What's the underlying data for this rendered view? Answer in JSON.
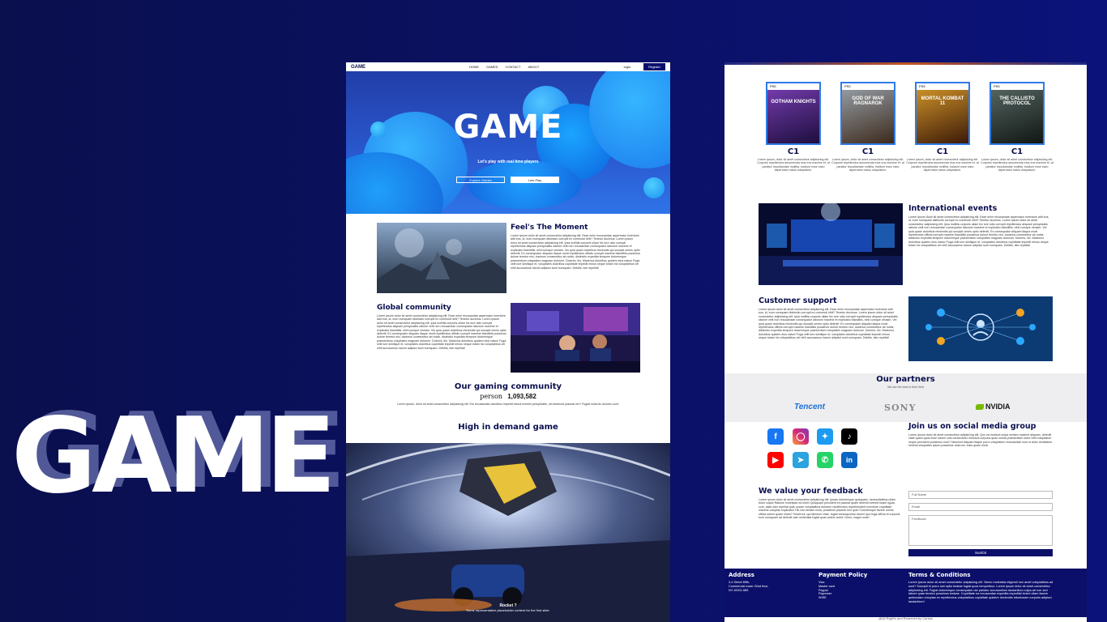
{
  "title_big": "GAME",
  "left_page": {
    "nav": {
      "brand": "GAME",
      "links": [
        "HOME",
        "GAMES",
        "CONTACT",
        "ABOUT"
      ],
      "login": "login",
      "register": "Register"
    },
    "hero": {
      "title": "GAME",
      "subtitle": "Let's play with real time players",
      "explore_btn": "Explore Games",
      "play_btn": "Lets Play"
    },
    "feels": {
      "title": "Feel's The Moment",
      "text": "Lorem ipsum dolor sit amet consectetur adipisicing elit. Esse enim recusandae aspernatur inventore adit eos, id, eum numquam distinctio corrupti ex commodi nihil? Tenetur ducimus. Lorem ipsum dolor sit amet consectetur adipisicing elit. Ipsa mollitia corporis ullam hic iure odio corrupti repellendus aliquam perspiciatis ratione velit non recusandae consequatur laborum maxime et explicabo blanditiis, nihil cumque veniam. Vel quia quam doloribus reiciendis qui suscipit omnis optio deleniti. Ex consequatur aliquam itaque modi repellendus officiis corrupti maxime blanditiis possimus dolore tenetur nisi, ducimus consectetur ab nobis, distinctio expedita tempore doloremque praesentium voluptates magnam dolorum. Dolores, illo. Maximus doloribus quidem eius natus! Fuga velit iure similique et, voluptates doloribus cupiditate impedit minus neque totam hic voluptatibus vel nihil accusamus harum adipisci sunt numquam. Debitis, iste repellat!"
    },
    "community": {
      "title": "Global community",
      "text": "Lorem ipsum dolor sit amet consectetur adipisicing elit. Esse enim recusandae aspernatur inventore adit eos, id, eum numquam distinctio corrupti ex commodi nihil? Tenetur ducimus. Lorem ipsum dolor sit amet consectetur adipisicing elit. Ipsa mollitia corporis ullam hic iure odio corrupti repellendus aliquam perspiciatis ratione velit non recusandae consequatur laborum maxime et explicabo blanditiis, nihil cumque veniam. Vel quia quam doloribus reiciendis qui suscipit omnis optio deleniti. Ex consequatur aliquam itaque modi repellendus officiis corrupti maxime blanditiis possimus dolore tenetur nisi, ducimus consectetur ab nobis, distinctio expedita tempore doloremque praesentium voluptates magnam dolorum. Dolores, illo. Maximus doloribus quidem eius natus! Fuga velit iure similique et, voluptates doloribus cupiditate impedit minus neque totam hic voluptatibus vel nihil accusamus harum adipisci sunt numquam. Debitis, iste repellat!"
    },
    "gaming_community": {
      "title": "Our gaming community",
      "person_label": "person",
      "count": "1,093,582",
      "text": "Lorem ipsum, dolor sit amet consectetur adipisicing elit. Est recusandae doloribus impedit minus eveniet perspiciatis, vel deserunt placeat rex? Fugiat nulla hic dolores sunt."
    },
    "high_demand": {
      "title": "High in demand game",
      "caption_title": "Rocket ?",
      "caption_text": "Some representative placeholder content for the first slide."
    }
  },
  "right_page": {
    "games": [
      {
        "name": "C1",
        "cover": "GOTHAM KNIGHTS",
        "desc": "Lorem ipsum, dolor sit amet consectetur adipisicing elit. Corporis repellendus assumenda eius eos maxime et, at pariatur repudiandae mollitia, incidunt esse iusto aspernatur natus voluptatum."
      },
      {
        "name": "C1",
        "cover": "GOD OF WAR RAGNAROK",
        "desc": "Lorem ipsum, dolor sit amet consectetur adipisicing elit. Corporis repellendus assumenda eius eos maxime et, at pariatur repudiandae mollitia, incidunt esse iusto aspernatur natus voluptatum."
      },
      {
        "name": "C1",
        "cover": "MORTAL KOMBAT 11",
        "desc": "Lorem ipsum, dolor sit amet consectetur adipisicing elit. Corporis repellendus assumenda eius eos maxime et, at pariatur repudiandae mollitia, incidunt esse iusto aspernatur natus voluptatum."
      },
      {
        "name": "C1",
        "cover": "THE CALLISTO PROTOCOL",
        "desc": "Lorem ipsum, dolor sit amet consectetur adipisicing elit. Corporis repellendus assumenda eius eos maxime et, at pariatur repudiandae mollitia, incidunt esse iusto aspernatur natus voluptatum."
      }
    ],
    "events": {
      "title": "International events",
      "text": "Lorem ipsum dolor sit amet consectetur adipisicing elit. Esse enim recusandae aspernatur inventore adit eos, id, eum numquam distinctio corrupti ex commodi nihil? Tenetur ducimus. Lorem ipsum dolor sit amet consectetur adipisicing elit. Ipsa mollitia corporis ullam hic iure odio corrupti repellendus aliquam perspiciatis ratione velit non recusandae consequatur laborum maxime et explicabo blanditiis, nihil cumque veniam. Vel quia quam doloribus reiciendis qui suscipit omnis optio deleniti. Ex consequatur aliquam itaque modi repellendus officiis corrupti maxime blanditiis possimus dolore tenetur nisi, ducimus consectetur ab nobis, distinctio expedita tempore doloremque praesentium voluptates magnam dolorum. Dolores, illo. Maximus doloribus quidem eius natus! Fuga velit iure similique et, voluptates doloribus cupiditate impedit minus neque totam hic voluptatibus vel nihil accusamus harum adipisci sunt numquam. Debitis, iste repellat!"
    },
    "support": {
      "title": "Customer support",
      "text": "Lorem ipsum dolor sit amet consectetur adipisicing elit. Esse enim recusandae aspernatur inventore adit eos, id, eum numquam distinctio corrupti ex commodi nihil? Tenetur ducimus. Lorem ipsum dolor sit amet consectetur adipisicing elit. Ipsa mollitia corporis ullam hic iure odio corrupti repellendus aliquam perspiciatis ratione velit non recusandae consequatur laborum maxime et explicabo blanditiis, nihil cumque veniam. Vel quia quam doloribus reiciendis qui suscipit omnis optio deleniti. Ex consequatur aliquam itaque modi repellendus officiis corrupti maxime blanditiis possimus dolore tenetur nisi, ducimus consectetur ab nobis, distinctio expedita tempore doloremque praesentium voluptates magnam dolorum. Dolores, illo. Maximus doloribus quidem eius natus! Fuga velit iure similique et, voluptates doloribus cupiditate impedit minus neque totam hic voluptatibus vel nihil accusamus harum adipisci sunt numquam. Debitis, iste repellat!"
    },
    "partners": {
      "title": "Our partners",
      "subtitle": "We are the best in their field",
      "logos": [
        "Tencent",
        "SONY",
        "NVIDIA"
      ]
    },
    "social": {
      "title": "Join us on social media group",
      "text": "Lorem ipsum dolor sit amet consectetur adipisicing elit. Quo ea incidunt culpa veniam maxime aliquam, deleniti vitae quam quos esse earum cuis consectetur nesciunt corporis quas soluta praesentium dolor velit voluptatum neque provident possimus eum? Nesciunt aliquam itaque porro voluptatum recusandae sunt ut dolor recitatione minima voluptates ipsum possimus dolorum, iusto quasi modi.",
      "icons": [
        "facebook-icon",
        "instagram-icon",
        "twitter-icon",
        "tiktok-icon",
        "youtube-icon",
        "telegram-icon",
        "whatsapp-icon",
        "linkedin-icon"
      ]
    },
    "feedback": {
      "title": "We value your feedback",
      "text": "Lorem ipsum dolor sit amet consectetur adipisicing elit. Ipsam doloremque quisquam, necessitatibus ullam dolor culpa! Ratione molestiae ea illum! Quisquam provident ex placeat quam deleniti eveniet totam ligula, cum, alias odio repellat quia, ipsam voluptatibus dolorem repellendus reprehenderit inventore cupiditate maxime voluptas explicabo! Hic nisi veniam nulla, possimus placeat rem quis? Doloremque facere omnis officia dolore quam ullam? Deserunt, qui laborum vitae, fugiat consequuntur facere quo fuga officia et corporis eum numquam ad deleniti odio molestias fugiat quas autem animi. Dolor, magni unde!",
      "name_placeholder": "Full Name",
      "email_placeholder": "Email",
      "feedback_placeholder": "Feedback",
      "submit": "Sumbit"
    },
    "footer": {
      "address_title": "Address",
      "address_lines": [
        "3-4 Street 89th,",
        "Commercial tower 22nd floor,",
        "NY-10001-585"
      ],
      "payment_title": "Payment Policy",
      "payment_lines": [
        "Visa",
        "Master card",
        "Paypal",
        "Payoneer",
        "WISE"
      ],
      "terms_title": "Terms & Conditions",
      "terms_text": "Lorem ipsum dolor sit amet consectetur adipisicing elit. Nemo molestias eligendi non amet voluptatibus ad sunt? Suscipit et porro sint optio beatae fugiat quos temporibus. Lorem ipsum dolor sit amet consectetur adipisicing elit. Fugiat doloremque consequatur ute pariatur accusantium laudantium culpa ab non sed labore quae tenetur possimus beatae. Cupiditate ea recusandae expedita expedita! Animi ullam facere quibusdam voluptas ex repellendus voluptatibus cupiditate quidem reiciendis laboriosam corporis adipisci laudantium!",
      "copyright": "@All Right's and Reserved by Cantos"
    }
  },
  "colors": {
    "navy": "#0a0f4e",
    "hero_blue": "#2a59d0",
    "accent_blue": "#2f7be8",
    "footer": "#0b0f6a"
  }
}
